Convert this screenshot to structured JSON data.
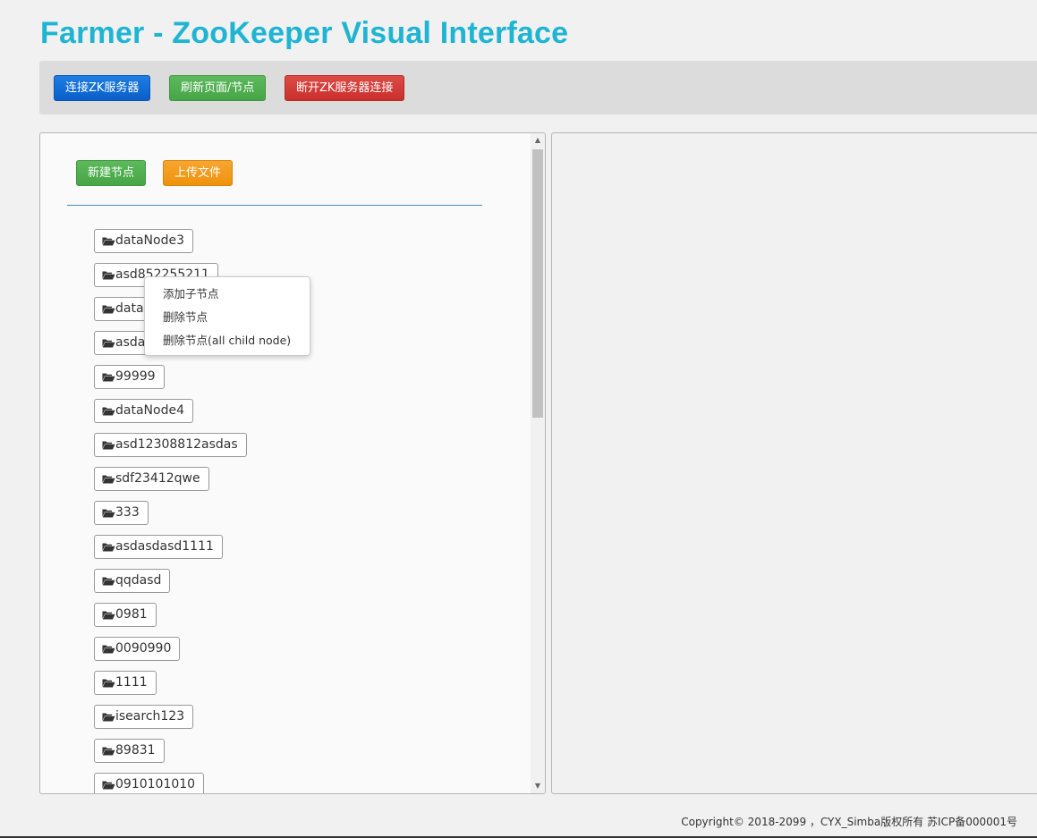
{
  "header": {
    "title": "Farmer - ZooKeeper Visual Interface"
  },
  "toolbar": {
    "connect_label": "连接ZK服务器",
    "refresh_label": "刷新页面/节点",
    "disconnect_label": "断开ZK服务器连接"
  },
  "tree_panel": {
    "new_node_label": "新建节点",
    "upload_label": "上传文件",
    "nodes": [
      "dataNode3",
      "asd852255211",
      "dataNode4",
      "asdasdasdasd",
      "99999",
      "dataNode4",
      "asd12308812asdas",
      "sdf23412qwe",
      "333",
      "asdasdasd1111",
      "qqdasd",
      "0981",
      "0090990",
      "1111",
      "isearch123",
      "89831",
      "0910101010"
    ]
  },
  "context_menu": {
    "items": [
      "添加子节点",
      "删除节点",
      "删除节点(all child node)"
    ]
  },
  "footer": {
    "copyright": "Copyright© 2018-2099 ，CYX_Simba版权所有 苏ICP备000001号"
  },
  "colors": {
    "title": "#1fb5d2",
    "primary": "#0a5ec9",
    "success": "#47a447",
    "danger": "#c9302c",
    "warning": "#ee920c"
  },
  "icons": {
    "node_icon": "folder-open-icon"
  }
}
